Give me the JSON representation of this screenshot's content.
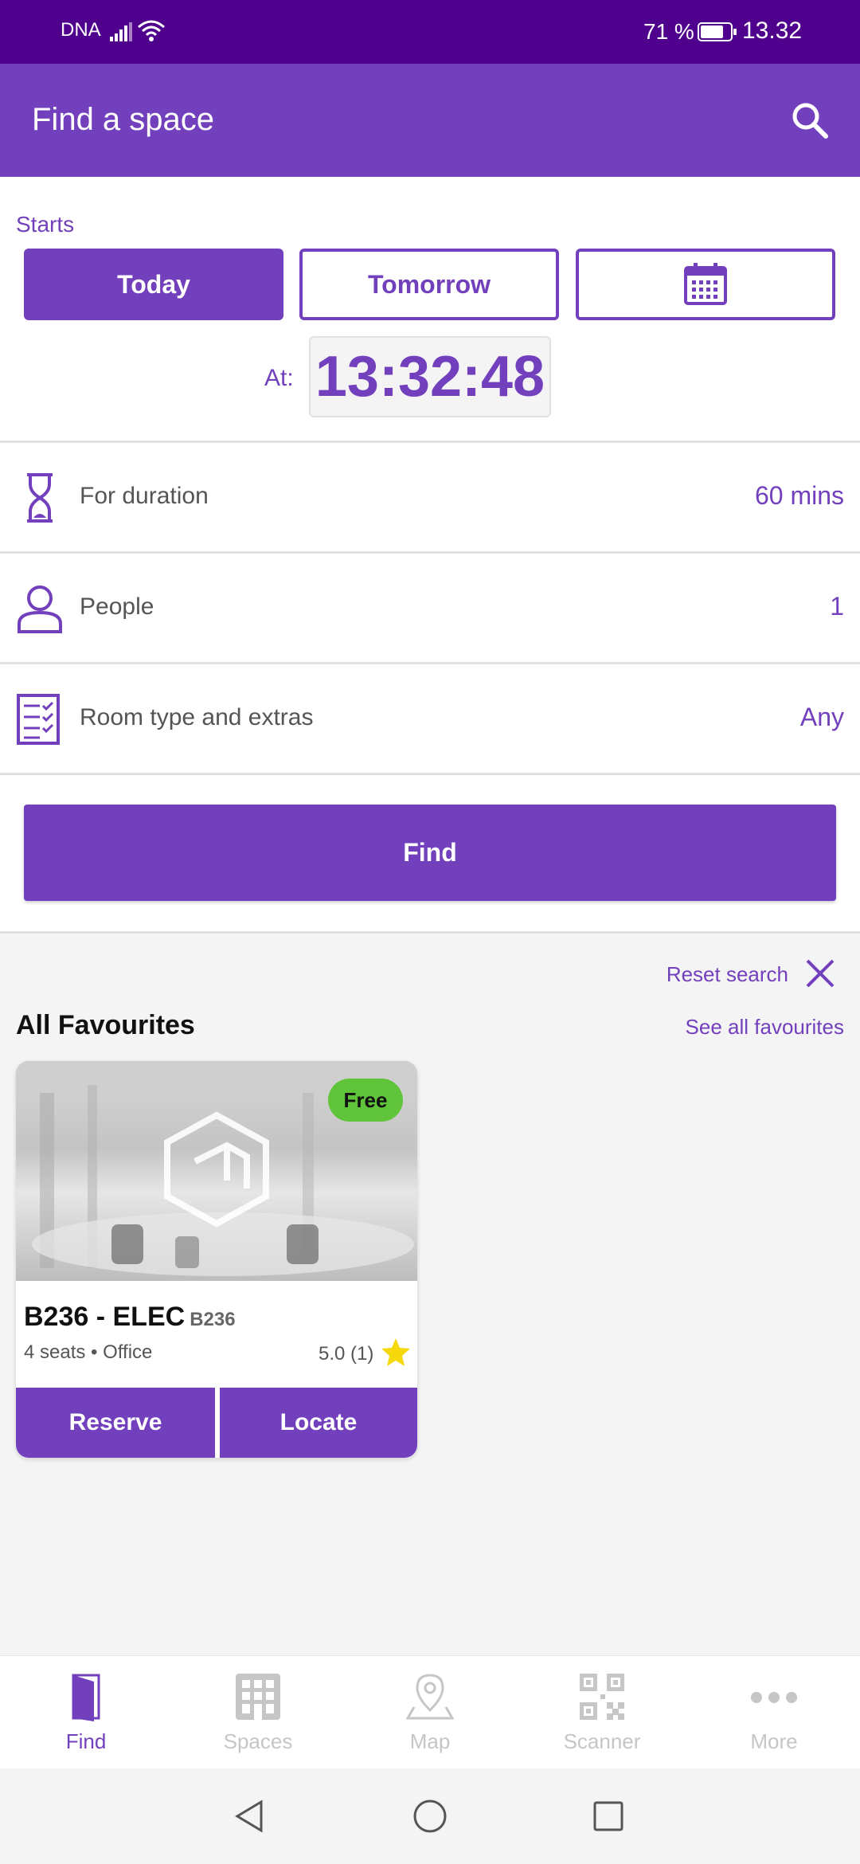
{
  "status_bar": {
    "carrier": "DNA",
    "battery_percent": "71 %",
    "time": "13.32"
  },
  "app_bar": {
    "title": "Find a space",
    "search_icon": "search-icon"
  },
  "starts": {
    "label": "Starts",
    "today_label": "Today",
    "tomorrow_label": "Tomorrow",
    "calendar_icon": "calendar-icon",
    "selected": "Today",
    "at_label": "At:",
    "time": "13:32:48"
  },
  "options": {
    "duration": {
      "label": "For duration",
      "value": "60 mins",
      "icon": "hourglass-icon"
    },
    "people": {
      "label": "People",
      "value": "1",
      "icon": "person-icon"
    },
    "room_type": {
      "label": "Room type and extras",
      "value": "Any",
      "icon": "checklist-icon"
    }
  },
  "find_button": "Find",
  "favourites": {
    "reset_label": "Reset search",
    "title": "All Favourites",
    "see_all": "See all favourites",
    "cards": [
      {
        "status": "Free",
        "status_color": "#5fc43a",
        "name": "B236 - ELEC",
        "code": "B236",
        "meta": "4 seats • Office",
        "rating": "5.0 (1)",
        "reserve_label": "Reserve",
        "locate_label": "Locate"
      }
    ]
  },
  "bottom_nav": {
    "items": [
      {
        "label": "Find",
        "icon": "door-icon",
        "active": true
      },
      {
        "label": "Spaces",
        "icon": "building-icon",
        "active": false
      },
      {
        "label": "Map",
        "icon": "map-pin-icon",
        "active": false
      },
      {
        "label": "Scanner",
        "icon": "qr-code-icon",
        "active": false
      },
      {
        "label": "More",
        "icon": "more-dots-icon",
        "active": false
      }
    ]
  },
  "colors": {
    "status_bar": "#4f008c",
    "brand": "#7340bd",
    "free": "#5fc43a",
    "star": "#f5d90a",
    "inactive_nav": "#c6c6c6"
  }
}
